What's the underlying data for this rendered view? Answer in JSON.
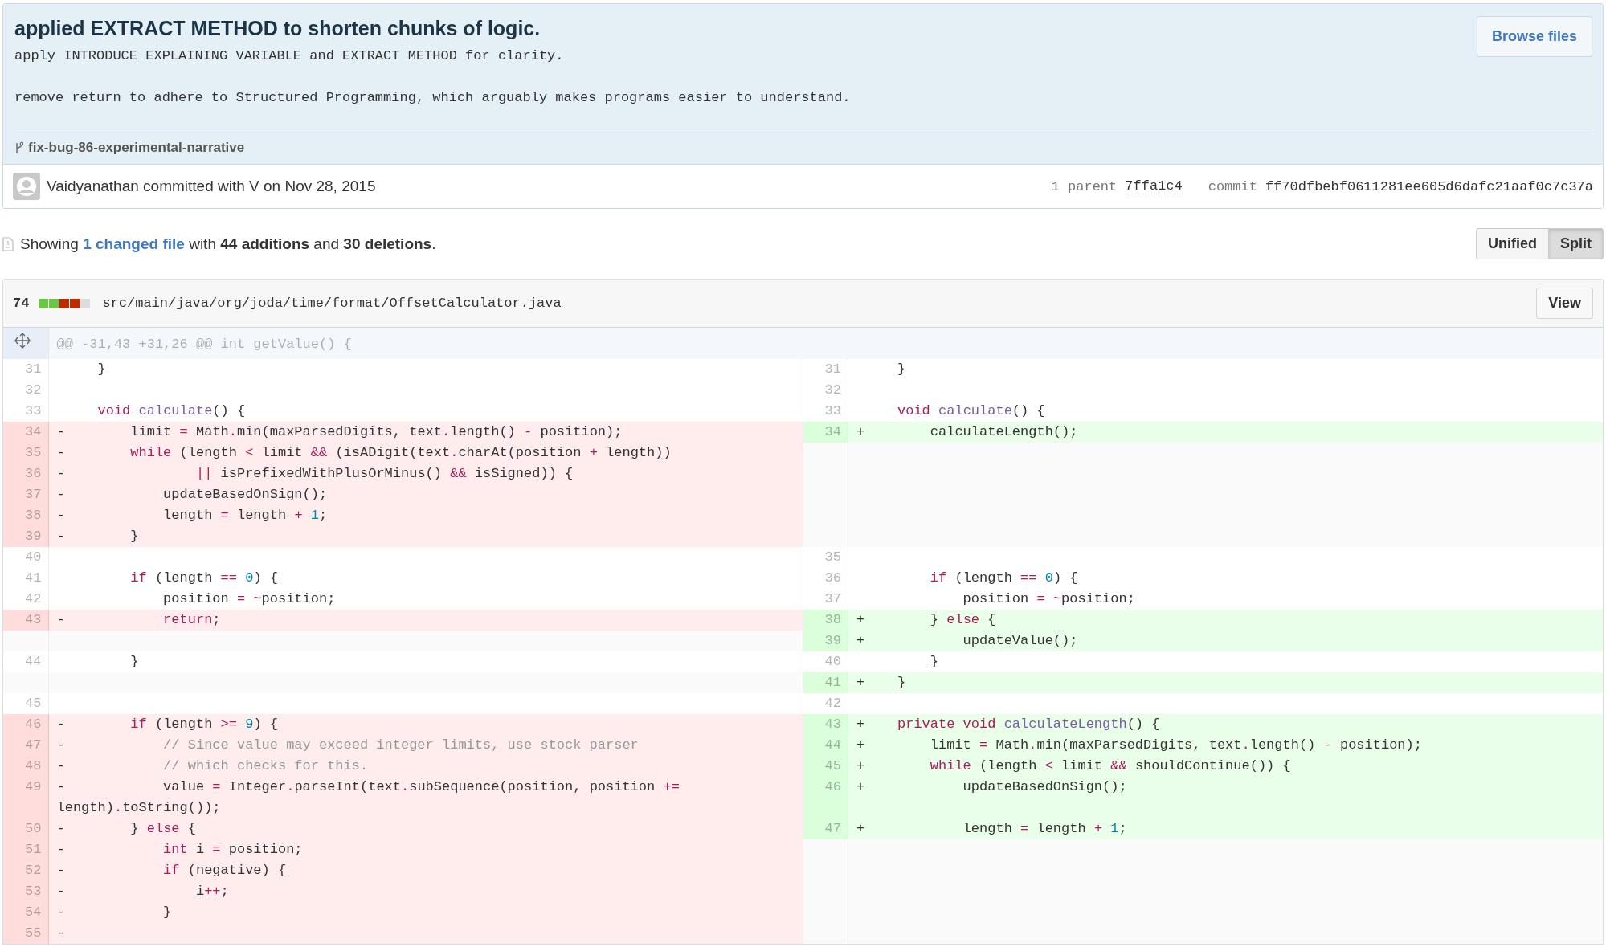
{
  "commit": {
    "title": "applied EXTRACT METHOD to shorten chunks of logic.",
    "browse_button": "Browse files",
    "description": [
      "apply INTRODUCE EXPLAINING VARIABLE and EXTRACT METHOD for clarity.",
      "remove return to adhere to Structured Programming, which arguably makes programs easier to understand."
    ],
    "branch": "fix-bug-86-experimental-narrative",
    "byline": "Vaidyanathan committed with V on Nov 28, 2015",
    "parent_label": "1 parent",
    "parent_sha": "7ffa1c4",
    "commit_label": "commit",
    "commit_sha": "ff70dfbebf0611281ee605d6dafc21aaf0c7c37a"
  },
  "summary": {
    "prefix": "Showing ",
    "link": "1 changed file",
    "suffix": " with **44 additions** and **30 deletions**."
  },
  "view_toggle": [
    {
      "label": "Unified",
      "selected": false
    },
    {
      "label": "Split",
      "selected": true
    }
  ],
  "file": {
    "changes": "74",
    "diffstat": [
      {
        "kind": "addition"
      },
      {
        "kind": "addition"
      },
      {
        "kind": "deletion"
      },
      {
        "kind": "deletion"
      },
      {
        "kind": "neutral"
      }
    ],
    "path": "src/main/java/org/joda/time/format/OffsetCalculator.java",
    "view_button": "View",
    "hunk": "@@ -31,43 +31,26 @@ int getValue() {",
    "rows": [
      {
        "left": {
          "kind": "context",
          "number": "31",
          "code": [
            "    }"
          ]
        },
        "right": {
          "kind": "context",
          "number": "31",
          "code": [
            "    }"
          ]
        }
      },
      {
        "left": {
          "kind": "context",
          "number": "32"
        },
        "right": {
          "kind": "context",
          "number": "32"
        }
      },
      {
        "left": {
          "kind": "context",
          "number": "33",
          "code": [
            {
              "text": "    void",
              "kind": "keyword"
            },
            {
              "text": " calculate",
              "kind": "function"
            },
            "() {"
          ]
        },
        "right": {
          "kind": "context",
          "number": "33",
          "code": [
            {
              "text": "    void",
              "kind": "keyword"
            },
            {
              "text": " calculate",
              "kind": "function"
            },
            "() {"
          ]
        }
      },
      {
        "left": {
          "kind": "deletion",
          "number": "34",
          "marker": "-",
          "code": [
            "        limit ",
            {
              "text": "=",
              "kind": "operator"
            },
            " Math",
            {
              "text": ".",
              "kind": "operator"
            },
            "min(maxParsedDigits, text",
            {
              "text": ".",
              "kind": "operator"
            },
            "length() ",
            {
              "text": "-",
              "kind": "operator"
            },
            " position);"
          ]
        },
        "right": {
          "kind": "addition",
          "number": "34",
          "marker": "+",
          "code": [
            "        calculateLength();"
          ]
        }
      },
      {
        "left": {
          "kind": "deletion",
          "number": "35",
          "marker": "-",
          "code": [
            {
              "text": "        while",
              "kind": "keyword"
            },
            " (length ",
            {
              "text": "<",
              "kind": "operator"
            },
            " limit ",
            {
              "text": "&&",
              "kind": "operator"
            },
            " (isADigit(text",
            {
              "text": ".",
              "kind": "operator"
            },
            "charAt(position ",
            {
              "text": "+",
              "kind": "operator"
            },
            " length))"
          ]
        },
        "right": {
          "kind": "empty"
        }
      },
      {
        "left": {
          "kind": "deletion",
          "number": "36",
          "marker": "-",
          "code": [
            {
              "text": "                ||",
              "kind": "operator"
            },
            " isPrefixedWithPlusOrMinus() ",
            {
              "text": "&&",
              "kind": "operator"
            },
            " isSigned)) {"
          ]
        },
        "right": {
          "kind": "empty"
        }
      },
      {
        "left": {
          "kind": "deletion",
          "number": "37",
          "marker": "-",
          "code": [
            "            updateBasedOnSign();"
          ]
        },
        "right": {
          "kind": "empty"
        }
      },
      {
        "left": {
          "kind": "deletion",
          "number": "38",
          "marker": "-",
          "code": [
            "            length ",
            {
              "text": "=",
              "kind": "operator"
            },
            " length ",
            {
              "text": "+",
              "kind": "operator"
            },
            {
              "text": " 1",
              "kind": "number"
            },
            ";"
          ]
        },
        "right": {
          "kind": "empty"
        }
      },
      {
        "left": {
          "kind": "deletion",
          "number": "39",
          "marker": "-",
          "code": [
            "        }"
          ]
        },
        "right": {
          "kind": "empty"
        }
      },
      {
        "left": {
          "kind": "context",
          "number": "40"
        },
        "right": {
          "kind": "context",
          "number": "35"
        }
      },
      {
        "left": {
          "kind": "context",
          "number": "41",
          "code": [
            {
              "text": "        if",
              "kind": "keyword"
            },
            " (length ",
            {
              "text": "==",
              "kind": "operator"
            },
            {
              "text": " 0",
              "kind": "number"
            },
            ") {"
          ]
        },
        "right": {
          "kind": "context",
          "number": "36",
          "code": [
            {
              "text": "        if",
              "kind": "keyword"
            },
            " (length ",
            {
              "text": "==",
              "kind": "operator"
            },
            {
              "text": " 0",
              "kind": "number"
            },
            ") {"
          ]
        }
      },
      {
        "left": {
          "kind": "context",
          "number": "42",
          "code": [
            "            position ",
            {
              "text": "=",
              "kind": "operator"
            },
            {
              "text": " ~",
              "kind": "operator"
            },
            "position;"
          ]
        },
        "right": {
          "kind": "context",
          "number": "37",
          "code": [
            "            position ",
            {
              "text": "=",
              "kind": "operator"
            },
            {
              "text": " ~",
              "kind": "operator"
            },
            "position;"
          ]
        }
      },
      {
        "left": {
          "kind": "deletion",
          "number": "43",
          "marker": "-",
          "code": [
            {
              "text": "            return",
              "kind": "keyword"
            },
            ";"
          ]
        },
        "right": {
          "kind": "addition",
          "number": "38",
          "marker": "+",
          "code": [
            "        } ",
            {
              "text": "else",
              "kind": "keyword"
            },
            " {"
          ]
        }
      },
      {
        "left": {
          "kind": "empty"
        },
        "right": {
          "kind": "addition",
          "number": "39",
          "marker": "+",
          "code": [
            "            updateValue();"
          ]
        }
      },
      {
        "left": {
          "kind": "context",
          "number": "44",
          "code": [
            "        }"
          ]
        },
        "right": {
          "kind": "context",
          "number": "40",
          "code": [
            "        }"
          ]
        }
      },
      {
        "left": {
          "kind": "empty"
        },
        "right": {
          "kind": "addition",
          "number": "41",
          "marker": "+",
          "code": [
            "    }"
          ]
        }
      },
      {
        "left": {
          "kind": "context",
          "number": "45"
        },
        "right": {
          "kind": "context",
          "number": "42"
        }
      },
      {
        "left": {
          "kind": "deletion",
          "number": "46",
          "marker": "-",
          "code": [
            {
              "text": "        if",
              "kind": "keyword"
            },
            " (length ",
            {
              "text": ">=",
              "kind": "operator"
            },
            {
              "text": " 9",
              "kind": "number"
            },
            ") {"
          ]
        },
        "right": {
          "kind": "addition",
          "number": "43",
          "marker": "+",
          "code": [
            {
              "text": "    private",
              "kind": "keyword"
            },
            {
              "text": " void",
              "kind": "keyword"
            },
            {
              "text": " calculateLength",
              "kind": "function"
            },
            "() {"
          ]
        }
      },
      {
        "left": {
          "kind": "deletion",
          "number": "47",
          "marker": "-",
          "code": [
            {
              "text": "            // Since value may exceed integer limits, use stock parser",
              "kind": "comment"
            }
          ]
        },
        "right": {
          "kind": "addition",
          "number": "44",
          "marker": "+",
          "code": [
            "        limit ",
            {
              "text": "=",
              "kind": "operator"
            },
            " Math",
            {
              "text": ".",
              "kind": "operator"
            },
            "min(maxParsedDigits, text",
            {
              "text": ".",
              "kind": "operator"
            },
            "length() ",
            {
              "text": "-",
              "kind": "operator"
            },
            " position);"
          ]
        }
      },
      {
        "left": {
          "kind": "deletion",
          "number": "48",
          "marker": "-",
          "code": [
            {
              "text": "            // which checks for this.",
              "kind": "comment"
            }
          ]
        },
        "right": {
          "kind": "addition",
          "number": "45",
          "marker": "+",
          "code": [
            {
              "text": "        while",
              "kind": "keyword"
            },
            " (length ",
            {
              "text": "<",
              "kind": "operator"
            },
            " limit ",
            {
              "text": "&&",
              "kind": "operator"
            },
            " shouldContinue()) {"
          ]
        }
      },
      {
        "left": {
          "kind": "deletion",
          "number": "49",
          "marker": "-",
          "code": [
            "            value ",
            {
              "text": "=",
              "kind": "operator"
            },
            " Integer",
            {
              "text": ".",
              "kind": "operator"
            },
            "parseInt(text",
            {
              "text": ".",
              "kind": "operator"
            },
            "subSequence(position, position ",
            {
              "text": "+=",
              "kind": "operator"
            },
            " length)",
            {
              "text": ".",
              "kind": "operator"
            },
            "toString());"
          ]
        },
        "right": {
          "kind": "addition",
          "number": "46",
          "marker": "+",
          "code": [
            "            updateBasedOnSign();"
          ]
        }
      },
      {
        "left": {
          "kind": "deletion",
          "number": "50",
          "marker": "-",
          "code": [
            "        } ",
            {
              "text": "else",
              "kind": "keyword"
            },
            " {"
          ]
        },
        "right": {
          "kind": "addition",
          "number": "47",
          "marker": "+",
          "code": [
            "            length ",
            {
              "text": "=",
              "kind": "operator"
            },
            " length ",
            {
              "text": "+",
              "kind": "operator"
            },
            {
              "text": " 1",
              "kind": "number"
            },
            ";"
          ]
        }
      },
      {
        "left": {
          "kind": "deletion",
          "number": "51",
          "marker": "-",
          "code": [
            {
              "text": "            int",
              "kind": "keyword"
            },
            " i ",
            {
              "text": "=",
              "kind": "operator"
            },
            " position;"
          ]
        },
        "right": {
          "kind": "empty"
        }
      },
      {
        "left": {
          "kind": "deletion",
          "number": "52",
          "marker": "-",
          "code": [
            {
              "text": "            if",
              "kind": "keyword"
            },
            " (negative) {"
          ]
        },
        "right": {
          "kind": "empty"
        }
      },
      {
        "left": {
          "kind": "deletion",
          "number": "53",
          "marker": "-",
          "code": [
            "                i",
            {
              "text": "++",
              "kind": "operator"
            },
            ";"
          ]
        },
        "right": {
          "kind": "empty"
        }
      },
      {
        "left": {
          "kind": "deletion",
          "number": "54",
          "marker": "-",
          "code": [
            "            }"
          ]
        },
        "right": {
          "kind": "empty"
        }
      },
      {
        "left": {
          "kind": "deletion",
          "number": "55",
          "marker": "-"
        },
        "right": {
          "kind": "empty"
        }
      }
    ]
  }
}
